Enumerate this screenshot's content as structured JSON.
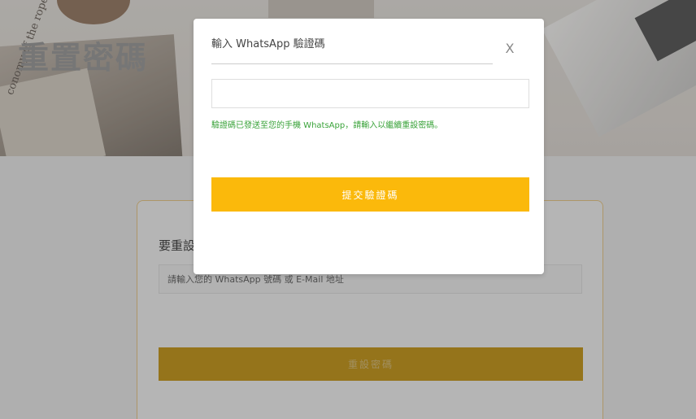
{
  "hero": {
    "title": "重置密碼",
    "newspaper_text": "conomy of the\nropean Union"
  },
  "form": {
    "heading": "要重設",
    "input_placeholder": "請輸入您的 WhatsApp 號碼 或 E-Mail 地址",
    "submit_label": "重設密碼"
  },
  "modal": {
    "title": "輸入 WhatsApp 驗證碼",
    "close_label": "X",
    "code_value": "",
    "hint": "驗證碼已發送至您的手機 WhatsApp，請輸入以繼續重設密碼。",
    "submit_label": "提交驗證碼"
  },
  "colors": {
    "accent": "#fbb90b",
    "hint_green": "#3aa33a",
    "form_button_dimmed": "#b88a0f"
  }
}
